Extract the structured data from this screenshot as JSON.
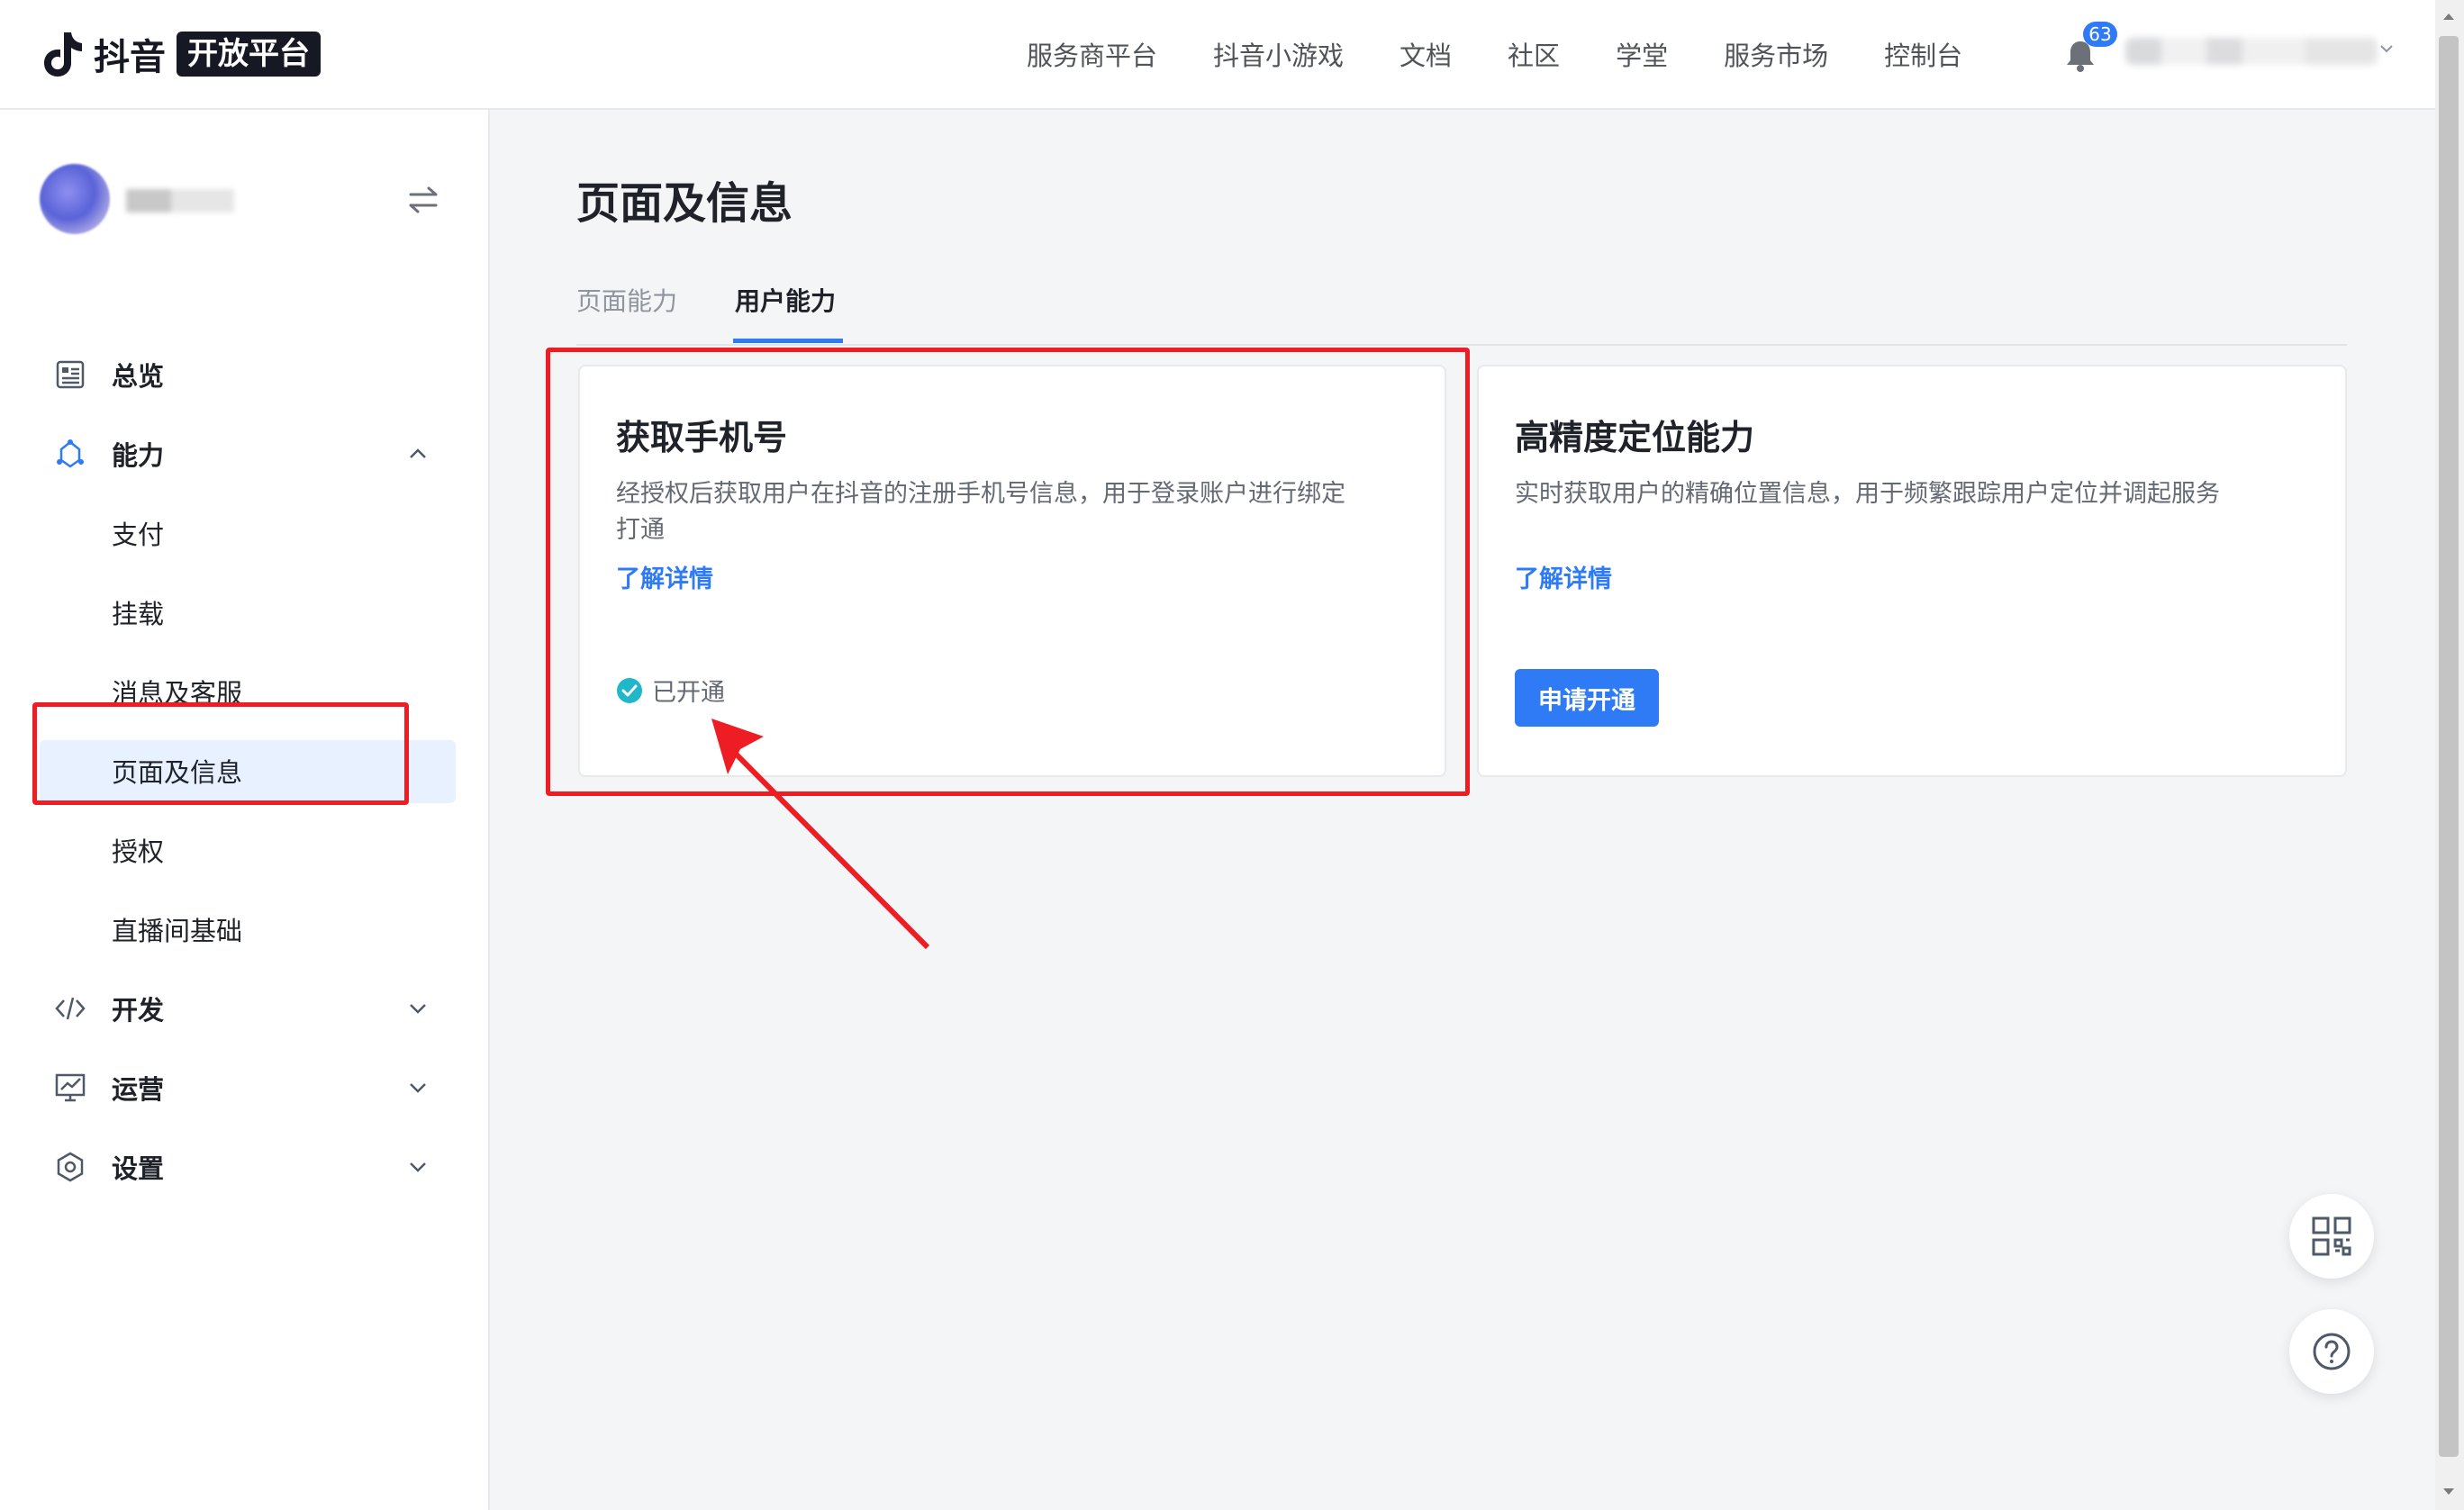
{
  "header": {
    "logo_text": "抖音",
    "logo_badge": "开放平台",
    "nav": [
      "服务商平台",
      "抖音小游戏",
      "文档",
      "社区",
      "学堂",
      "服务市场",
      "控制台"
    ],
    "notification_count": "63"
  },
  "sidebar": {
    "menu": [
      {
        "label": "总览",
        "icon": "overview-icon"
      },
      {
        "label": "能力",
        "icon": "capability-icon",
        "expanded": true,
        "children": [
          "支付",
          "挂载",
          "消息及客服",
          "页面及信息",
          "授权",
          "直播间基础"
        ],
        "active_child": "页面及信息"
      },
      {
        "label": "开发",
        "icon": "code-icon"
      },
      {
        "label": "运营",
        "icon": "operations-icon"
      },
      {
        "label": "设置",
        "icon": "settings-icon"
      }
    ]
  },
  "main": {
    "title": "页面及信息",
    "tabs": [
      {
        "label": "页面能力",
        "active": false
      },
      {
        "label": "用户能力",
        "active": true
      }
    ],
    "cards": [
      {
        "title": "获取手机号",
        "description": "经授权后获取用户在抖音的注册手机号信息，用于登录账户进行绑定打通",
        "link": "了解详情",
        "status": "已开通"
      },
      {
        "title": "高精度定位能力",
        "description": "实时获取用户的精确位置信息，用于频繁跟踪用户定位并调起服务",
        "link": "了解详情",
        "button": "申请开通"
      }
    ]
  },
  "colors": {
    "accent": "#2f7bf6",
    "annotation": "#ee1d24",
    "success": "#1fb7c9"
  }
}
